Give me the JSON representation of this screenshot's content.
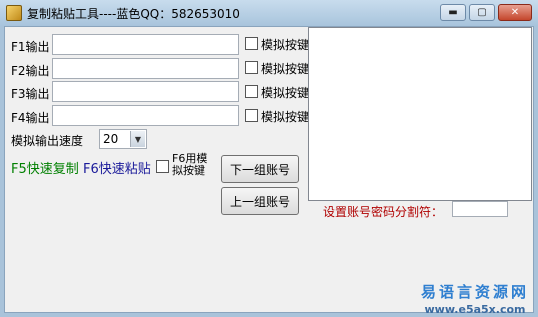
{
  "window": {
    "title": "复制粘贴工具----蓝色QQ：582653010",
    "controls": {
      "minimize": "▬",
      "maximize": "▢",
      "close": "✕"
    }
  },
  "rows": [
    {
      "label": "F1输出",
      "value": "",
      "checkbox_label": "模拟按键",
      "checked": false
    },
    {
      "label": "F2输出",
      "value": "",
      "checkbox_label": "模拟按键",
      "checked": false
    },
    {
      "label": "F3输出",
      "value": "",
      "checkbox_label": "模拟按键",
      "checked": false
    },
    {
      "label": "F4输出",
      "value": "",
      "checkbox_label": "模拟按键",
      "checked": false
    }
  ],
  "speed": {
    "label": "模拟输出速度",
    "selected": "20"
  },
  "hotkeys": {
    "f5_text": "F5快速复制",
    "f6_text": "F6快速粘贴",
    "f6_check_label": "F6用模拟按键",
    "f6_checked": false
  },
  "buttons": {
    "next_account": "下一组账号",
    "prev_account": "上一组账号"
  },
  "separator": {
    "label": "设置账号密码分割符：",
    "value": ""
  },
  "watermark": {
    "line1": "易语言资源网",
    "line2": "www.e5a5x.com"
  },
  "colors": {
    "f5_text": "#008000",
    "f6_text": "#1a1a9a",
    "separator_label": "#b00000",
    "titlebar": "#a8c4dc"
  }
}
